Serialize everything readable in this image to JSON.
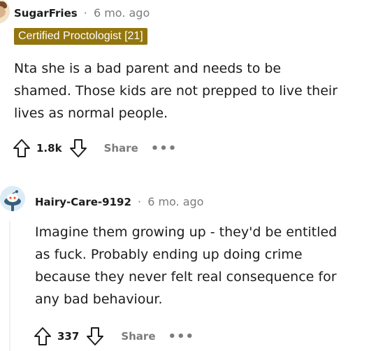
{
  "comments": [
    {
      "username": "SugarFries",
      "separator": "·",
      "time": "6 mo. ago",
      "flair": "Certified Proctologist [21]",
      "lines": [
        "Nta she is a bad parent and needs to be",
        "shamed. Those kids are not prepped to live their",
        "lives as normal people."
      ],
      "votes": "1.8k",
      "share_label": "Share",
      "more_label": "•••"
    },
    {
      "username": "Hairy-Care-9192",
      "separator": "·",
      "time": "6 mo. ago",
      "lines": [
        "Imagine them growing up - they'd be entitled",
        "as fuck. Probably ending up doing crime",
        "because they never felt real consequence for",
        "any bad behaviour."
      ],
      "votes": "337",
      "share_label": "Share",
      "more_label": "•••"
    }
  ],
  "icons": {
    "upvote": "arrow-up-outline-icon",
    "downvote": "arrow-down-outline-icon",
    "more": "ellipsis-icon"
  }
}
